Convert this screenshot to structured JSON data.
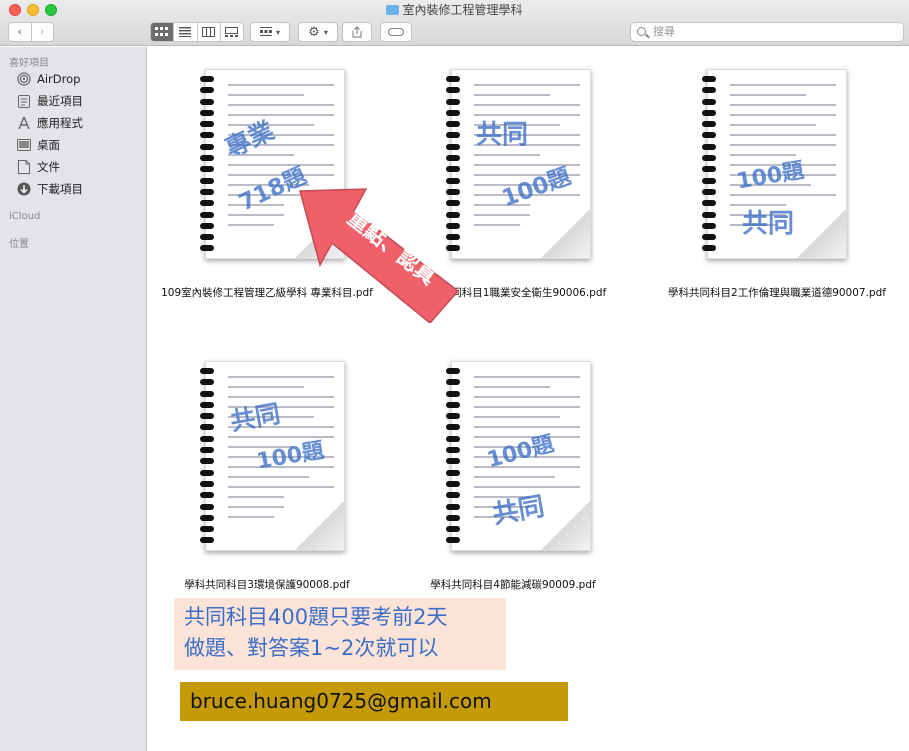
{
  "window": {
    "title": "室內裝修工程管理學科"
  },
  "toolbar": {
    "back_glyph": "‹",
    "forward_glyph": "›",
    "search_placeholder": "搜尋"
  },
  "sidebar": {
    "favorites_header": "喜好項目",
    "items": [
      {
        "label": "AirDrop",
        "icon": "airdrop-icon"
      },
      {
        "label": "最近項目",
        "icon": "recents-icon"
      },
      {
        "label": "應用程式",
        "icon": "applications-icon"
      },
      {
        "label": "桌面",
        "icon": "desktop-icon"
      },
      {
        "label": "文件",
        "icon": "documents-icon"
      },
      {
        "label": "下載項目",
        "icon": "downloads-icon"
      }
    ],
    "icloud_header": "iCloud",
    "locations_header": "位置"
  },
  "files": [
    {
      "name": "109室內裝修工程管理乙級學科 專業科目.pdf",
      "overlay": [
        "專業",
        "718題"
      ]
    },
    {
      "name": "學科共同科目1職業安全衛生90006.pdf",
      "overlay": [
        "共同",
        "100題"
      ]
    },
    {
      "name": "學科共同科目2工作倫理與職業道德90007.pdf",
      "overlay": [
        "100題",
        "共同"
      ]
    },
    {
      "name": "學科共同科目3環境保護90008.pdf",
      "overlay": [
        "共同",
        "100題"
      ]
    },
    {
      "name": "學科共同科目4節能減碳90009.pdf",
      "overlay": [
        "100題",
        "共同"
      ]
    }
  ],
  "annotations": {
    "arrow_text": "重點、認真",
    "note_lines": [
      "共同科目400題只要考前2天",
      "做題、對答案1~2次就可以"
    ],
    "email": "bruce.huang0725@gmail.com"
  },
  "colors": {
    "arrow_fill": "#f0606a",
    "note_bg": "#fbe3d8",
    "note_text": "#3c6ec8",
    "email_bg": "#c49a06"
  }
}
